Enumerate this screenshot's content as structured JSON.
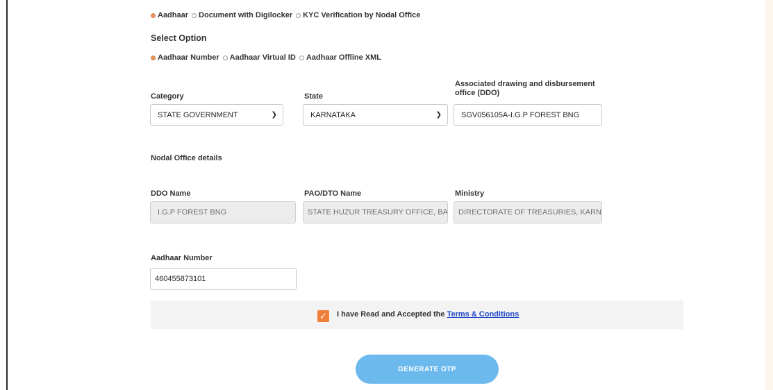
{
  "verification_methods": {
    "options": [
      "Aadhaar",
      "Document with Digilocker",
      "KYC Verification by Nodal Office"
    ],
    "selected": 0
  },
  "select_option": {
    "heading": "Select Option",
    "options": [
      "Aadhaar Number",
      "Aadhaar Virtual ID",
      "Aadhaar Offline XML"
    ],
    "selected": 0
  },
  "category": {
    "label": "Category",
    "value": "STATE GOVERNMENT"
  },
  "state": {
    "label": "State",
    "value": "KARNATAKA"
  },
  "ddo": {
    "label": "Associated drawing and disbursement office (DDO)",
    "value": "SGV056105A-I.G.P FOREST BNG"
  },
  "nodal_office": {
    "heading": "Nodal Office details",
    "ddo_name": {
      "label": "DDO Name",
      "value": "I.G.P FOREST BNG"
    },
    "pao_dto_name": {
      "label": "PAO/DTO Name",
      "value": "STATE HUZUR TREASURY OFFICE, BAN"
    },
    "ministry": {
      "label": "Ministry",
      "value": "DIRECTORATE OF TREASURIES, KARNA"
    }
  },
  "aadhaar_number": {
    "label": "Aadhaar Number",
    "value": "460455873101"
  },
  "terms": {
    "checked": true,
    "prefix": "I have Read and Accepted the",
    "link_text": "Terms & Conditions"
  },
  "generate_otp_label": "GENERATE OTP",
  "colors": {
    "accent_orange": "#f07f3a",
    "button_blue": "#6cb9ee",
    "link_blue": "#1a44c9"
  }
}
